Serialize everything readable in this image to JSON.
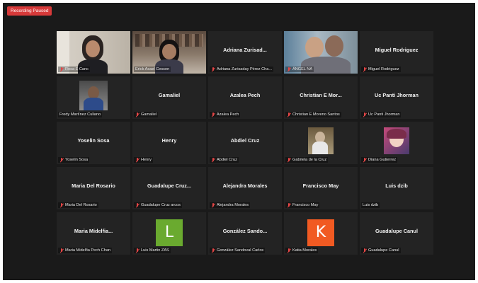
{
  "recording": {
    "label": "Recording Paused"
  },
  "colors": {
    "recording_badge": "#d73a3a",
    "active_speaker_border": "#a8c94f",
    "tile_bg": "#232323",
    "avatar_green": "#6aaa2f",
    "avatar_orange": "#f15a22"
  },
  "participants": [
    {
      "tile_name": "",
      "caption": "Rosa E Canc",
      "muted": true,
      "feed": "video",
      "icon": "video-feed"
    },
    {
      "tile_name": "",
      "caption": "Erick Asael Cessen",
      "muted": false,
      "feed": "video",
      "icon": "video-feed"
    },
    {
      "tile_name": "Adriana Zurisad...",
      "caption": "Adriana Zurisaday Pérez Cha...",
      "muted": true,
      "feed": "name"
    },
    {
      "tile_name": "",
      "caption": "ÁNGEL NA",
      "muted": true,
      "feed": "video",
      "icon": "video-feed"
    },
    {
      "tile_name": "Miguel Rodriguez",
      "caption": "Miguel Rodriguez",
      "muted": true,
      "feed": "name"
    },
    {
      "tile_name": "",
      "caption": "Fredy Martínez Culiano",
      "muted": false,
      "feed": "video",
      "icon": "video-feed"
    },
    {
      "tile_name": "Gamaliel",
      "caption": "Gamaliel",
      "muted": true,
      "feed": "name"
    },
    {
      "tile_name": "Azalea Pech",
      "caption": "Azalea Pech",
      "muted": true,
      "feed": "name"
    },
    {
      "tile_name": "Christian E Mor...",
      "caption": "Christian E Moreno Santos",
      "muted": true,
      "feed": "name"
    },
    {
      "tile_name": "Uc Panti Jhorman",
      "caption": "Uc Panti Jhorman",
      "muted": true,
      "feed": "name"
    },
    {
      "tile_name": "Yoselin Sosa",
      "caption": "Yoselin Sosa",
      "muted": true,
      "feed": "name"
    },
    {
      "tile_name": "Henry",
      "caption": "Henry",
      "muted": true,
      "feed": "name"
    },
    {
      "tile_name": "Abdiel Cruz",
      "caption": "Abdiel Cruz",
      "muted": true,
      "feed": "name"
    },
    {
      "tile_name": "",
      "caption": "Gabriela de la Cruz",
      "muted": true,
      "feed": "photo",
      "icon": "profile-photo"
    },
    {
      "tile_name": "",
      "caption": "Diana Gutierrez",
      "muted": true,
      "feed": "photo",
      "icon": "profile-photo"
    },
    {
      "tile_name": "Maria Del Rosario",
      "caption": "Maria Del Rosario",
      "muted": true,
      "feed": "name"
    },
    {
      "tile_name": "Guadalupe Cruz...",
      "caption": "Guadalupe Cruz arcos",
      "muted": true,
      "feed": "name"
    },
    {
      "tile_name": "Alejandra Morales",
      "caption": "Alejandra Morales",
      "muted": true,
      "feed": "name"
    },
    {
      "tile_name": "Francisco May",
      "caption": "Francisco May",
      "muted": true,
      "feed": "name"
    },
    {
      "tile_name": "Luis dzib",
      "caption": "Luis dzib",
      "muted": false,
      "feed": "name"
    },
    {
      "tile_name": "Maria Midelfia...",
      "caption": "Maria Midelfia Pech Chan",
      "muted": true,
      "feed": "name"
    },
    {
      "tile_name": "",
      "caption": "Luis Martin ZAS",
      "muted": true,
      "feed": "letter",
      "letter": "L",
      "color": "#6aaa2f"
    },
    {
      "tile_name": "González Sando...",
      "caption": "González Sandoval Carlos",
      "muted": true,
      "feed": "name"
    },
    {
      "tile_name": "",
      "caption": "Katia Morales",
      "muted": true,
      "feed": "letter",
      "letter": "K",
      "color": "#f15a22"
    },
    {
      "tile_name": "Guadalupe Canul",
      "caption": "Guadalupe Canul",
      "muted": true,
      "feed": "name"
    }
  ]
}
